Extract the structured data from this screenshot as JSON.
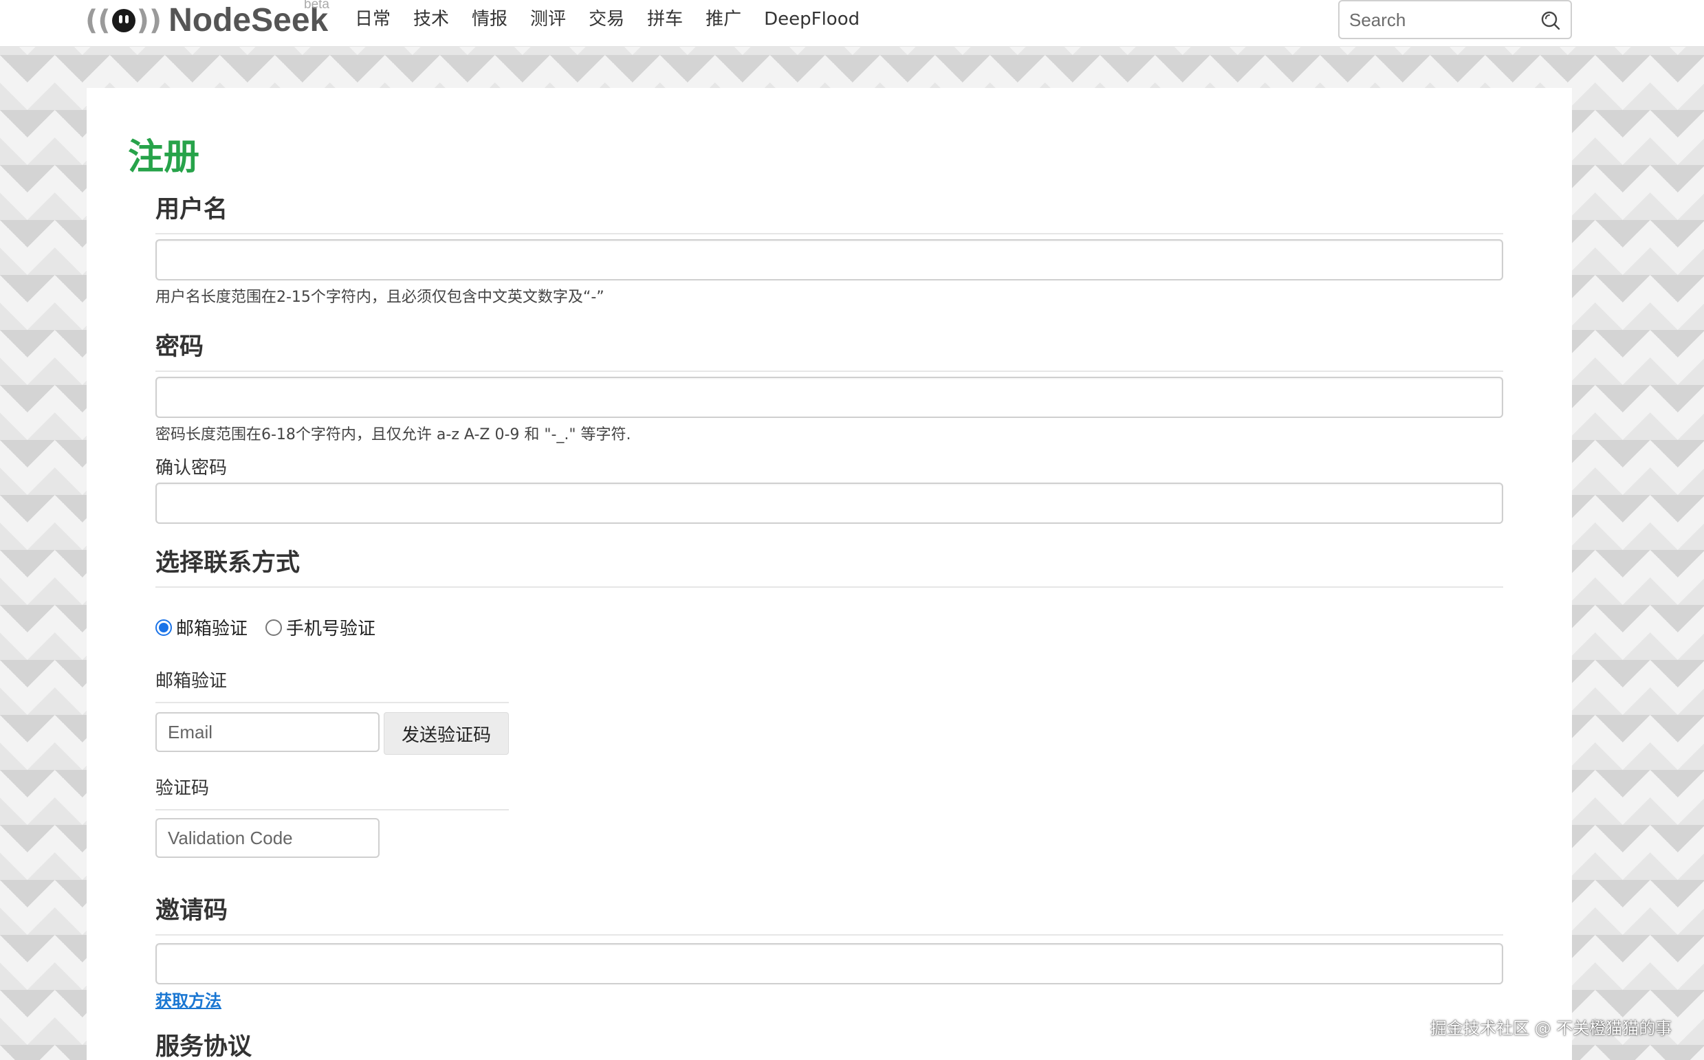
{
  "header": {
    "logo_text": "NodeSeek",
    "logo_badge": "beta",
    "nav": [
      "日常",
      "技术",
      "情报",
      "测评",
      "交易",
      "拼车",
      "推广",
      "DeepFlood"
    ],
    "search_placeholder": "Search"
  },
  "form": {
    "title": "注册",
    "username": {
      "heading": "用户名",
      "value": "",
      "help": "用户名长度范围在2-15个字符内，且必须仅包含中文英文数字及“-”"
    },
    "password": {
      "heading": "密码",
      "value": "",
      "help": "密码长度范围在6-18个字符内，且仅允许 a-z A-Z 0-9 和 \"-_.\" 等字符."
    },
    "confirm_password": {
      "label": "确认密码",
      "value": ""
    },
    "contact": {
      "heading": "选择联系方式",
      "options": [
        {
          "label": "邮箱验证",
          "checked": true
        },
        {
          "label": "手机号验证",
          "checked": false
        }
      ]
    },
    "email": {
      "label": "邮箱验证",
      "placeholder": "Email",
      "value": "",
      "send_button": "发送验证码"
    },
    "code": {
      "label": "验证码",
      "placeholder": "Validation Code",
      "value": ""
    },
    "invite": {
      "heading": "邀请码",
      "value": "",
      "link": "获取方法"
    },
    "terms": {
      "heading": "服务协议"
    }
  },
  "watermark": "掘金技术社区 @ 不关橙猫猫的事"
}
